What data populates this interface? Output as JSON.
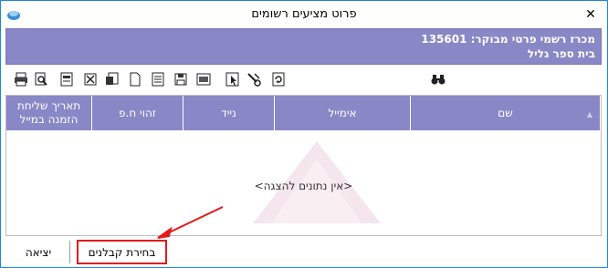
{
  "window": {
    "title": "פרוט מציעים רשומים",
    "close_glyph": "✕"
  },
  "header": {
    "line1": "מכרז רשמי פרטי מבוקר: 135601",
    "line2": "בית ספר גליל"
  },
  "toolbar": {
    "icons": [
      "printer-icon",
      "print-preview-icon",
      "pdf-icon",
      "excel-icon",
      "export-icon",
      "blank-page-icon",
      "document-icon",
      "save-icon",
      "grid-icon",
      "select-icon",
      "tools-icon",
      "refresh-icon",
      "search-binoculars-icon"
    ]
  },
  "grid": {
    "columns": [
      "שם",
      "אימייל",
      "נייד",
      "זהוי ח.פ",
      "תאריך שליחת הזמנה במייל"
    ],
    "sort_glyph": "▲",
    "empty_message": "<אין נתונים להצגה>"
  },
  "footer": {
    "exit_label": "יציאה",
    "choose_label": "בחירת קבלנים"
  },
  "colors": {
    "header_purple": "#8987c6",
    "highlight_red": "#e01b1b",
    "frame_blue": "#1d87d2"
  }
}
